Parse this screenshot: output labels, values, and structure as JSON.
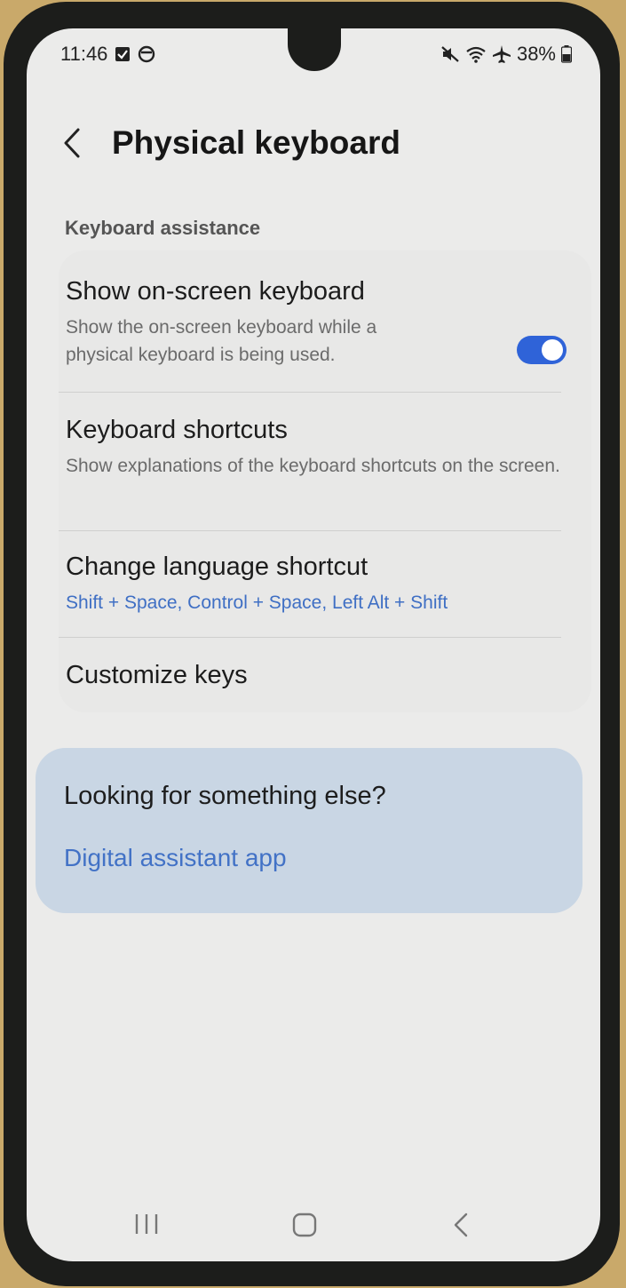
{
  "status_bar": {
    "time": "11:46",
    "battery": "38%"
  },
  "header": {
    "title": "Physical keyboard"
  },
  "section": {
    "label": "Keyboard assistance"
  },
  "settings": [
    {
      "title": "Show on-screen keyboard",
      "subtitle": "Show the on-screen keyboard while a physical keyboard is being used.",
      "toggle_on": true
    },
    {
      "title": "Keyboard shortcuts",
      "subtitle": "Show explanations of the keyboard shortcuts on the screen."
    },
    {
      "title": "Change language shortcut",
      "subtitle": "Shift + Space, Control + Space, Left Alt + Shift"
    },
    {
      "title": "Customize keys"
    }
  ],
  "suggestions": {
    "title": "Looking for something else?",
    "link": "Digital assistant app"
  },
  "colors": {
    "accent": "#2f63d8",
    "link": "#4272c6",
    "background": "#ebebea",
    "suggestion_bg": "#c9d6e4"
  }
}
